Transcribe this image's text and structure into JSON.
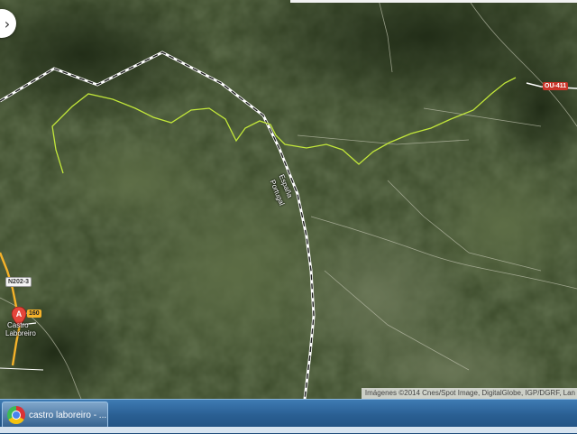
{
  "map": {
    "attribution": "Imágenes ©2014 Cnes/Spot Image, DigitalGlobe, IGP/DGRF, Lan",
    "border_labels": [
      "España",
      "Portugal"
    ],
    "road_labels": {
      "n202_3": "N202-3",
      "ou_411": "OU-411",
      "r160": "160"
    },
    "place": {
      "marker_letter": "A",
      "name_line1": "Castro",
      "name_line2": "Laboreiro"
    },
    "colors": {
      "track": "#c8ee3a",
      "road_highlight": "#f5b22a",
      "shield_red": "#c8352a"
    }
  },
  "navigation": {
    "arrow_icon": "chevron-right-icon",
    "arrow_glyph": "›"
  },
  "taskbar": {
    "app_icon": "chrome-icon",
    "task_label": "castro laboreiro - ..."
  }
}
